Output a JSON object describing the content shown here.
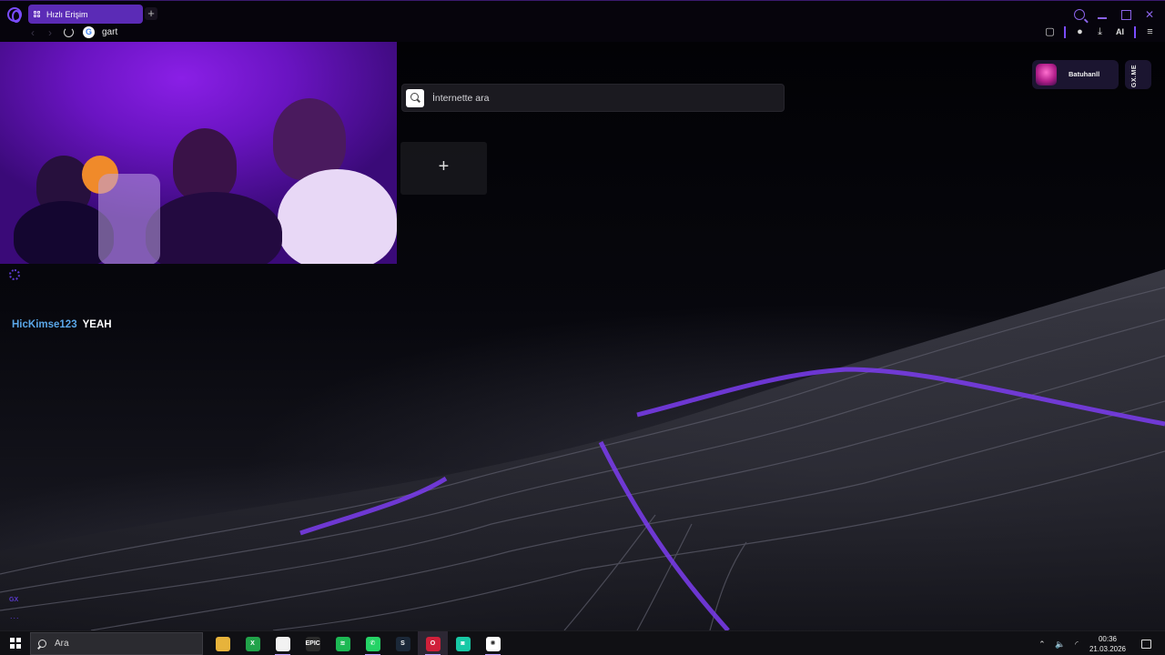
{
  "browser": {
    "tab_label": "Hızlı Erişim",
    "new_tab_symbol": "+",
    "address_text": "gart",
    "address_icon": "google-icon",
    "toolbar_ai_label": "AI",
    "accent_color": "#7a4cff"
  },
  "page": {
    "search_placeholder": "İnternette ara",
    "speed_dial_add_symbol": "+",
    "chat": {
      "username": "HicKimse123",
      "message": "YEAH",
      "username_color": "#5aa7e8"
    },
    "profile_name": "Batuhanll",
    "gxme_label": "GX.ME",
    "gx_mark": "GX",
    "more_label": "..."
  },
  "taskbar": {
    "search_label": "Ara",
    "apps": [
      {
        "name": "file-explorer-icon",
        "glyph": "",
        "color": "#e7b33b",
        "running": false
      },
      {
        "name": "xbox-icon",
        "glyph": "X",
        "color": "#21a34a",
        "running": false
      },
      {
        "name": "notepad-icon",
        "glyph": "",
        "color": "#f2f2f2",
        "running": true
      },
      {
        "name": "epic-games-icon",
        "glyph": "EPIC",
        "color": "#2a2a2a",
        "running": false
      },
      {
        "name": "spotify-icon",
        "glyph": "≋",
        "color": "#1db954",
        "running": false
      },
      {
        "name": "whatsapp-icon",
        "glyph": "✆",
        "color": "#25d366",
        "running": true
      },
      {
        "name": "steam-icon",
        "glyph": "S",
        "color": "#1b2838",
        "running": false
      },
      {
        "name": "opera-gx-icon",
        "glyph": "O",
        "color": "#d0203a",
        "running": true
      },
      {
        "name": "discord-like-icon",
        "glyph": "◙",
        "color": "#18c9a6",
        "running": false
      },
      {
        "name": "chatgpt-icon",
        "glyph": "✺",
        "color": "#ffffff",
        "running": true
      }
    ],
    "time": "00:36",
    "date": "21.03.2026"
  }
}
